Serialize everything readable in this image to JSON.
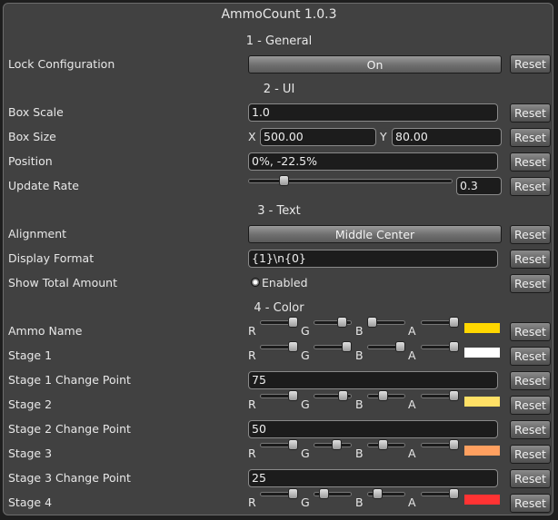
{
  "title": "AmmoCount 1.0.3",
  "reset_label": "Reset",
  "sections": {
    "general": "1 - General",
    "ui": "2 - UI",
    "text": "3 - Text",
    "color": "4 - Color"
  },
  "general": {
    "lock_label": "Lock Configuration",
    "lock_value": "On"
  },
  "ui": {
    "box_scale_label": "Box Scale",
    "box_scale_value": "1.0",
    "box_size_label": "Box Size",
    "box_size_x_prefix": "X",
    "box_size_x": "500.00",
    "box_size_y_prefix": "Y",
    "box_size_y": "80.00",
    "position_label": "Position",
    "position_value": "0%, -22.5%",
    "update_rate_label": "Update Rate",
    "update_rate_value": "0.3",
    "update_rate_fraction": 0.16
  },
  "text": {
    "alignment_label": "Alignment",
    "alignment_value": "Middle Center",
    "display_format_label": "Display Format",
    "display_format_value": "{1}\\n{0}",
    "show_total_label": "Show Total Amount",
    "show_total_value": "Enabled"
  },
  "channel_labels": [
    "R",
    "G",
    "B",
    "A"
  ],
  "color": {
    "ammo_name": {
      "label": "Ammo Name",
      "swatch": "#ffd700",
      "channels": [
        1.0,
        0.84,
        0.0,
        1.0
      ]
    },
    "stage1": {
      "label": "Stage 1",
      "swatch": "#ffffff",
      "channels": [
        1.0,
        1.0,
        1.0,
        1.0
      ]
    },
    "stage1_change": {
      "label": "Stage 1 Change Point",
      "value": "75"
    },
    "stage2": {
      "label": "Stage 2",
      "swatch": "#ffe066",
      "channels": [
        1.0,
        0.88,
        0.4,
        1.0
      ]
    },
    "stage2_change": {
      "label": "Stage 2 Change Point",
      "value": "50"
    },
    "stage3": {
      "label": "Stage 3",
      "swatch": "#ffa060",
      "channels": [
        1.0,
        0.63,
        0.38,
        1.0
      ]
    },
    "stage3_change": {
      "label": "Stage 3 Change Point",
      "value": "25"
    },
    "stage4": {
      "label": "Stage 4",
      "swatch": "#ff3333",
      "channels": [
        1.0,
        0.2,
        0.2,
        1.0
      ]
    }
  }
}
